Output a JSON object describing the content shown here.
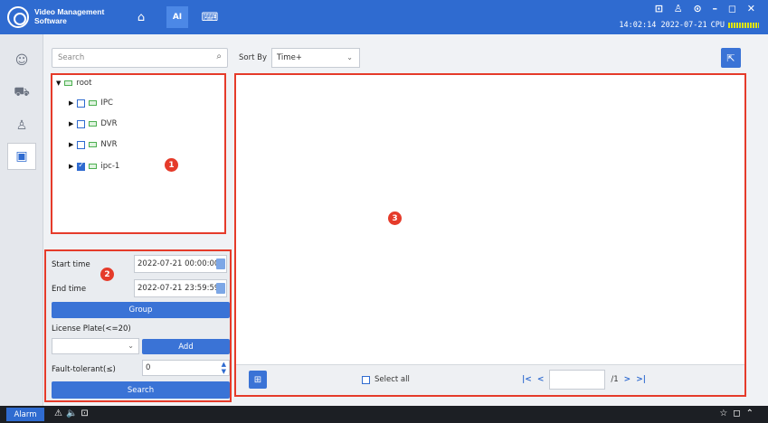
{
  "app": {
    "title_line1": "Video Management",
    "title_line2": "Software",
    "clock": "14:02:14 2022-07-21",
    "cpu_label": "CPU",
    "window_controls": "⊡ ♙ ⊙ – ◻ ✕"
  },
  "topnav": [
    {
      "icon": "home-icon",
      "glyph": "⌂"
    },
    {
      "icon": "ai-icon",
      "glyph": "AI"
    },
    {
      "icon": "keyboard-icon",
      "glyph": "⌨"
    }
  ],
  "leftnav": [
    {
      "icon": "face-icon",
      "glyph": "☺"
    },
    {
      "icon": "vehicle-icon",
      "glyph": "⛟"
    },
    {
      "icon": "person-search-icon",
      "glyph": "♙"
    },
    {
      "icon": "plate-search-icon",
      "glyph": "▣"
    }
  ],
  "search": {
    "placeholder": "Search",
    "icon": "search-icon"
  },
  "tree": {
    "root": "root",
    "items": [
      {
        "label": "IPC",
        "checked": false
      },
      {
        "label": "DVR",
        "checked": false
      },
      {
        "label": "NVR",
        "checked": false
      },
      {
        "label": "ipc-1",
        "checked": true
      }
    ]
  },
  "badges": {
    "one": "1",
    "two": "2",
    "three": "3"
  },
  "form": {
    "start_label": "Start time",
    "start_value": "2022-07-21 00:00:00",
    "end_label": "End time",
    "end_value": "2022-07-21 23:59:59",
    "group_button": "Group",
    "plate_label": "License Plate(<=20)",
    "add_button": "Add",
    "fault_label": "Fault-tolerant(≤)",
    "fault_value": "0",
    "search_button": "Search"
  },
  "sort": {
    "label": "Sort By",
    "value": "Time+"
  },
  "results": {
    "select_all": "Select all",
    "page_total": "/1"
  },
  "taskbar": {
    "alarm": "Alarm"
  }
}
